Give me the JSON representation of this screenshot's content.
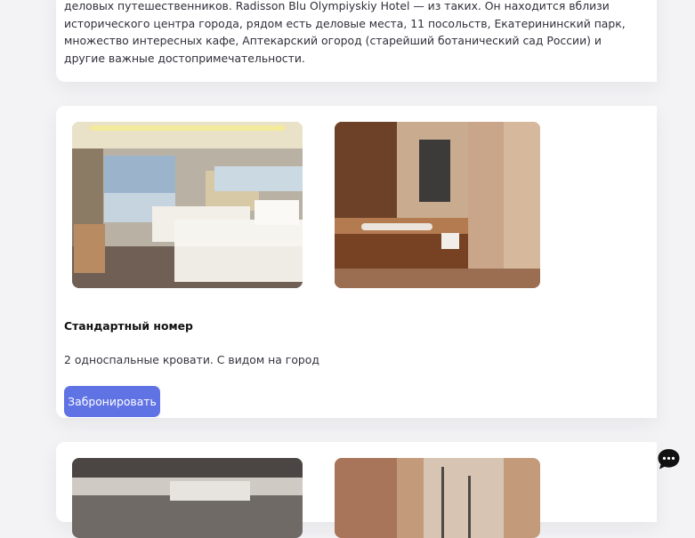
{
  "hotel": {
    "description": "деловых путешественников. Radisson Blu Olympiyskiy Hotel — из таких. Он находится вблизи исторического центра города, рядом есть деловые места, 11 посольств, Екатерининский парк, множество интересных кафе, Аптекарский огород (старейший ботанический сад России) и другие важные достопримечательности."
  },
  "rooms": [
    {
      "title": "Стандартный номер",
      "info": "2 односпальные кровати. С видом на город",
      "book_label": "Забронировать",
      "photos": [
        "bedroom-photo",
        "bathroom-photo"
      ]
    }
  ],
  "next_room": {
    "photos": [
      "room-ceiling-photo",
      "room-glass-door-photo"
    ]
  },
  "chat": {
    "icon": "chat-bubble-icon",
    "color": "#111111"
  },
  "colors": {
    "accent": "#6073e4",
    "background": "#f3f3f5",
    "card": "#ffffff"
  }
}
